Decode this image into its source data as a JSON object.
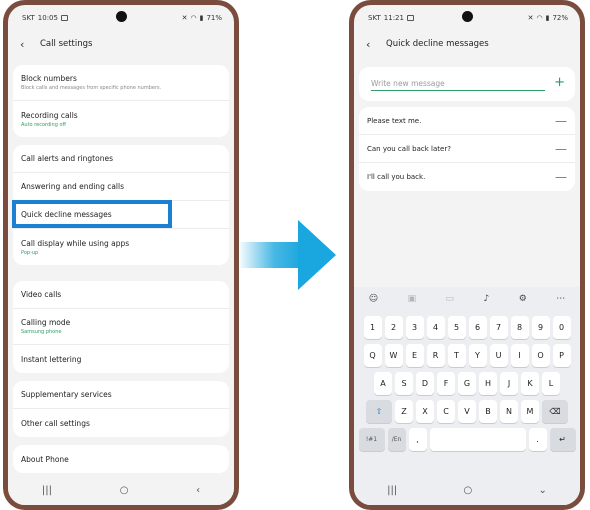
{
  "left_phone": {
    "status": {
      "carrier": "SKT",
      "time": "10:05",
      "battery": "71%"
    },
    "appbar": {
      "back_icon": "chevron-left-icon",
      "title": "Call settings"
    },
    "groups": [
      [
        {
          "label": "Block numbers",
          "sub": "Block calls and messages from specific phone numbers.",
          "sub_color": "gray"
        },
        {
          "label": "Recording calls",
          "sub": "Auto recording off",
          "sub_color": "green"
        }
      ],
      [
        {
          "label": "Call alerts and ringtones"
        },
        {
          "label": "Answering and ending calls"
        },
        {
          "label": "Quick decline messages",
          "highlighted": true
        },
        {
          "label": "Call display while using apps",
          "sub": "Pop-up",
          "sub_color": "green"
        }
      ],
      [
        {
          "label": "Video calls"
        },
        {
          "label": "Calling mode",
          "sub": "Samsung phone",
          "sub_color": "green"
        },
        {
          "label": "Instant lettering"
        }
      ],
      [
        {
          "label": "Supplementary services"
        },
        {
          "label": "Other call settings"
        }
      ],
      [
        {
          "label": "About Phone"
        }
      ]
    ],
    "navbar": {
      "recent": "|||",
      "home": "○",
      "back": "‹"
    }
  },
  "right_phone": {
    "status": {
      "carrier": "SKT",
      "time": "11:21",
      "battery": "72%"
    },
    "appbar": {
      "back_icon": "chevron-left-icon",
      "title": "Quick decline messages"
    },
    "input": {
      "placeholder": "Write new message",
      "add_icon": "plus-icon"
    },
    "messages": [
      "Please text me.",
      "Can you call back later?",
      "I'll call you back."
    ],
    "keyboard": {
      "toolbar_icons": [
        "emoji-icon",
        "sticker-icon",
        "gif-icon",
        "microphone-icon",
        "settings-icon",
        "more-icon"
      ],
      "rows": [
        [
          "1",
          "2",
          "3",
          "4",
          "5",
          "6",
          "7",
          "8",
          "9",
          "0"
        ],
        [
          "Q",
          "W",
          "E",
          "R",
          "T",
          "Y",
          "U",
          "I",
          "O",
          "P"
        ],
        [
          "A",
          "S",
          "D",
          "F",
          "G",
          "H",
          "J",
          "K",
          "L"
        ],
        [
          "⇧",
          "Z",
          "X",
          "C",
          "V",
          "B",
          "N",
          "M",
          "⌫"
        ],
        [
          "!#1",
          "/En",
          ",",
          "space",
          ".",
          "↵"
        ]
      ]
    },
    "navbar": {
      "recent": "|||",
      "home": "○",
      "back": "⌄"
    }
  },
  "colors": {
    "accent_green": "#2e9d64",
    "highlight_blue": "#1d7fd2",
    "delete_red": "#e0484c",
    "arrow_cyan": "#1aa6de"
  }
}
